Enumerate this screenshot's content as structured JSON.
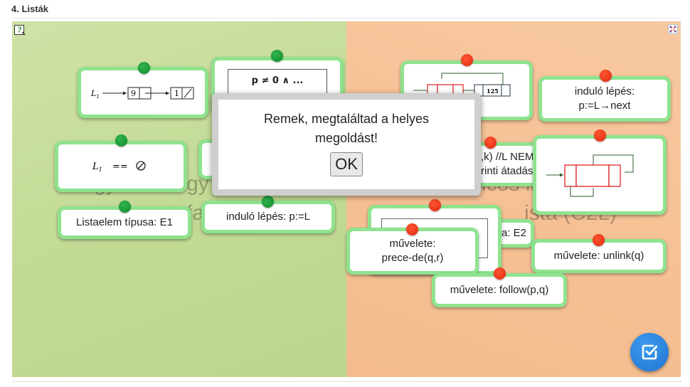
{
  "section": {
    "title": "4. Listák"
  },
  "background": {
    "left_text_1": "Egyszerű egy",
    "left_text_2": "fa",
    "right_text_1": "ncos li",
    "right_text_2": "istá (C2L)"
  },
  "cards": {
    "card_l1_9": {
      "l1": "L",
      "sub": "1",
      "v1": "9",
      "v2": "1"
    },
    "card_p_cond": {
      "text": "p ≠ 0  ∧ ..."
    },
    "card_l1_null": {
      "l1": "L",
      "sub": "1",
      "op": "=="
    },
    "card_list_type_e1": {
      "text": "Listaelem típusa: E1"
    },
    "card_start_l": {
      "text": "induló lépés: p:=L"
    },
    "card_diagram_125": {
      "value": "125"
    },
    "card_start_next": {
      "text": "induló lépés: p:=L→next"
    },
    "card_k_not": {
      "text": ",k) //L NEM rinti átadása"
    },
    "card_list_type_e2": {
      "text": ":a: E2"
    },
    "card_precede": {
      "text": "művelete: prece-de(q,r)"
    },
    "card_unlink": {
      "text": "művelete: unlink(q)"
    },
    "card_follow": {
      "text": "művelete: follow(p,q)"
    }
  },
  "dialog": {
    "message": "Remek, megtaláltad a helyes megoldást!",
    "ok_label": "OK"
  },
  "icons": {
    "help": "help-icon",
    "fullscreen": "fullscreen-icon",
    "check": "check-icon"
  },
  "colors": {
    "card_border": "#8fe38f",
    "dot_green": "#1b9a35",
    "dot_red": "#f23a18",
    "check_button": "#2a86e0"
  }
}
